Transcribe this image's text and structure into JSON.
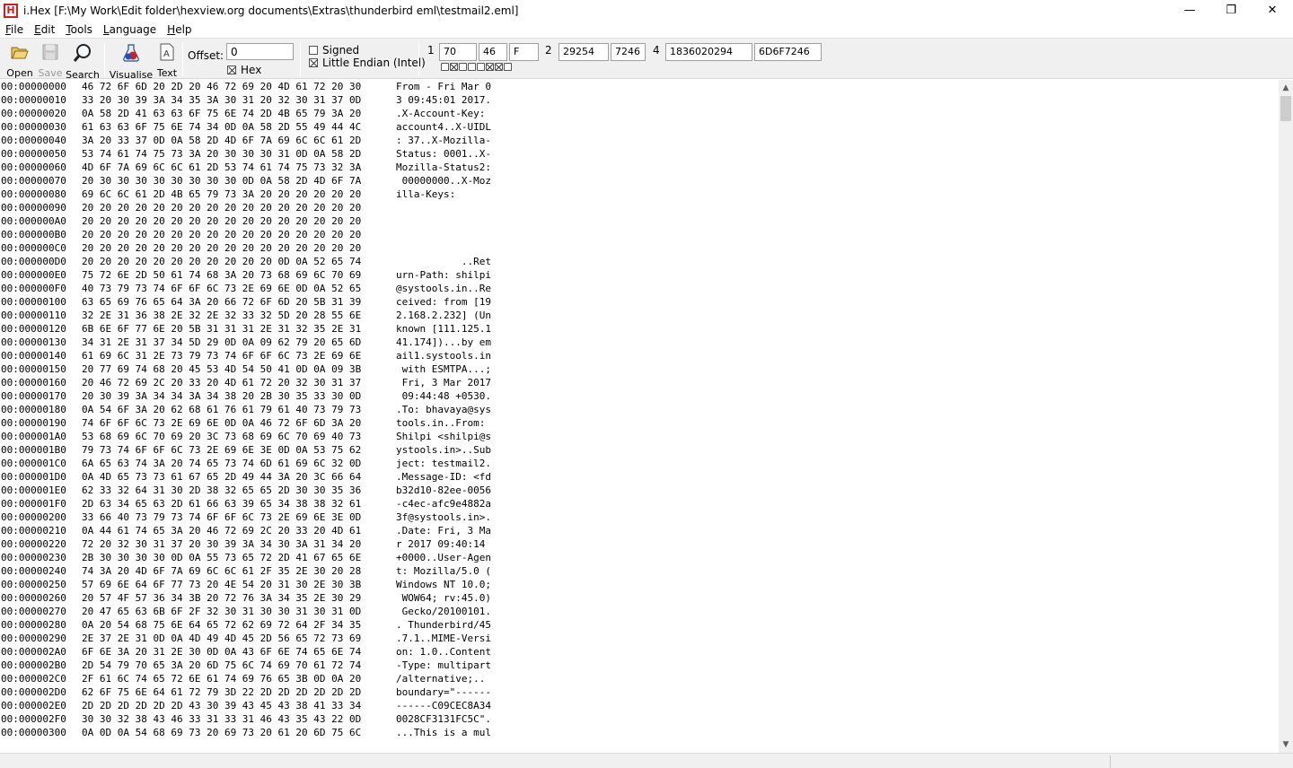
{
  "window": {
    "title": "i.Hex [F:\\My Work\\Edit folder\\hexview.org documents\\Extras\\thunderbird eml\\testmail2.eml]",
    "icon_letter": "H",
    "minimize": "—",
    "restore": "❐",
    "close": "✕"
  },
  "menu": [
    {
      "first": "F",
      "rest": "ile"
    },
    {
      "first": "E",
      "rest": "dit"
    },
    {
      "first": "T",
      "rest": "ools"
    },
    {
      "first": "L",
      "rest": "anguage"
    },
    {
      "first": "H",
      "rest": "elp"
    }
  ],
  "toolbar": {
    "open": "Open",
    "save": "Save",
    "search": "Search",
    "visualise": "Visualise",
    "text": "Text",
    "offset_label": "Offset:",
    "offset_value": "0",
    "hex_label": "Hex",
    "signed_label": "Signed",
    "little_endian_label": "Little Endian (Intel)",
    "n1": "1",
    "n2": "2",
    "n4": "4",
    "byte_dec": "70",
    "byte_hex": "46",
    "byte_char": "F",
    "word_dec": "29254",
    "word_hex": "7246",
    "dword_dec": "1836020294",
    "dword_hex": "6D6F7246",
    "bits": [
      false,
      true,
      false,
      false,
      false,
      true,
      true,
      false
    ]
  },
  "hex_rows": [
    {
      "off": "00:00000000",
      "hex": "46 72 6F 6D 20 2D 20 46 72 69 20 4D 61 72 20 30",
      "text": "From - Fri Mar 0"
    },
    {
      "off": "00:00000010",
      "hex": "33 20 30 39 3A 34 35 3A 30 31 20 32 30 31 37 0D",
      "text": "3 09:45:01 2017."
    },
    {
      "off": "00:00000020",
      "hex": "0A 58 2D 41 63 63 6F 75 6E 74 2D 4B 65 79 3A 20",
      "text": ".X-Account-Key: "
    },
    {
      "off": "00:00000030",
      "hex": "61 63 63 6F 75 6E 74 34 0D 0A 58 2D 55 49 44 4C",
      "text": "account4..X-UIDL"
    },
    {
      "off": "00:00000040",
      "hex": "3A 20 33 37 0D 0A 58 2D 4D 6F 7A 69 6C 6C 61 2D",
      "text": ": 37..X-Mozilla-"
    },
    {
      "off": "00:00000050",
      "hex": "53 74 61 74 75 73 3A 20 30 30 30 31 0D 0A 58 2D",
      "text": "Status: 0001..X-"
    },
    {
      "off": "00:00000060",
      "hex": "4D 6F 7A 69 6C 6C 61 2D 53 74 61 74 75 73 32 3A",
      "text": "Mozilla-Status2:"
    },
    {
      "off": "00:00000070",
      "hex": "20 30 30 30 30 30 30 30 30 0D 0A 58 2D 4D 6F 7A",
      "text": " 00000000..X-Moz"
    },
    {
      "off": "00:00000080",
      "hex": "69 6C 6C 61 2D 4B 65 79 73 3A 20 20 20 20 20 20",
      "text": "illa-Keys:      "
    },
    {
      "off": "00:00000090",
      "hex": "20 20 20 20 20 20 20 20 20 20 20 20 20 20 20 20",
      "text": "                "
    },
    {
      "off": "00:000000A0",
      "hex": "20 20 20 20 20 20 20 20 20 20 20 20 20 20 20 20",
      "text": "                "
    },
    {
      "off": "00:000000B0",
      "hex": "20 20 20 20 20 20 20 20 20 20 20 20 20 20 20 20",
      "text": "                "
    },
    {
      "off": "00:000000C0",
      "hex": "20 20 20 20 20 20 20 20 20 20 20 20 20 20 20 20",
      "text": "                "
    },
    {
      "off": "00:000000D0",
      "hex": "20 20 20 20 20 20 20 20 20 20 20 0D 0A 52 65 74",
      "text": "           ..Ret"
    },
    {
      "off": "00:000000E0",
      "hex": "75 72 6E 2D 50 61 74 68 3A 20 73 68 69 6C 70 69",
      "text": "urn-Path: shilpi"
    },
    {
      "off": "00:000000F0",
      "hex": "40 73 79 73 74 6F 6F 6C 73 2E 69 6E 0D 0A 52 65",
      "text": "@systools.in..Re"
    },
    {
      "off": "00:00000100",
      "hex": "63 65 69 76 65 64 3A 20 66 72 6F 6D 20 5B 31 39",
      "text": "ceived: from [19"
    },
    {
      "off": "00:00000110",
      "hex": "32 2E 31 36 38 2E 32 2E 32 33 32 5D 20 28 55 6E",
      "text": "2.168.2.232] (Un"
    },
    {
      "off": "00:00000120",
      "hex": "6B 6E 6F 77 6E 20 5B 31 31 31 2E 31 32 35 2E 31",
      "text": "known [111.125.1"
    },
    {
      "off": "00:00000130",
      "hex": "34 31 2E 31 37 34 5D 29 0D 0A 09 62 79 20 65 6D",
      "text": "41.174])...by em"
    },
    {
      "off": "00:00000140",
      "hex": "61 69 6C 31 2E 73 79 73 74 6F 6F 6C 73 2E 69 6E",
      "text": "ail1.systools.in"
    },
    {
      "off": "00:00000150",
      "hex": "20 77 69 74 68 20 45 53 4D 54 50 41 0D 0A 09 3B",
      "text": " with ESMTPA...;"
    },
    {
      "off": "00:00000160",
      "hex": "20 46 72 69 2C 20 33 20 4D 61 72 20 32 30 31 37",
      "text": " Fri, 3 Mar 2017"
    },
    {
      "off": "00:00000170",
      "hex": "20 30 39 3A 34 34 3A 34 38 20 2B 30 35 33 30 0D",
      "text": " 09:44:48 +0530."
    },
    {
      "off": "00:00000180",
      "hex": "0A 54 6F 3A 20 62 68 61 76 61 79 61 40 73 79 73",
      "text": ".To: bhavaya@sys"
    },
    {
      "off": "00:00000190",
      "hex": "74 6F 6F 6C 73 2E 69 6E 0D 0A 46 72 6F 6D 3A 20",
      "text": "tools.in..From: "
    },
    {
      "off": "00:000001A0",
      "hex": "53 68 69 6C 70 69 20 3C 73 68 69 6C 70 69 40 73",
      "text": "Shilpi <shilpi@s"
    },
    {
      "off": "00:000001B0",
      "hex": "79 73 74 6F 6F 6C 73 2E 69 6E 3E 0D 0A 53 75 62",
      "text": "ystools.in>..Sub"
    },
    {
      "off": "00:000001C0",
      "hex": "6A 65 63 74 3A 20 74 65 73 74 6D 61 69 6C 32 0D",
      "text": "ject: testmail2."
    },
    {
      "off": "00:000001D0",
      "hex": "0A 4D 65 73 73 61 67 65 2D 49 44 3A 20 3C 66 64",
      "text": ".Message-ID: <fd"
    },
    {
      "off": "00:000001E0",
      "hex": "62 33 32 64 31 30 2D 38 32 65 65 2D 30 30 35 36",
      "text": "b32d10-82ee-0056"
    },
    {
      "off": "00:000001F0",
      "hex": "2D 63 34 65 63 2D 61 66 63 39 65 34 38 38 32 61",
      "text": "-c4ec-afc9e4882a"
    },
    {
      "off": "00:00000200",
      "hex": "33 66 40 73 79 73 74 6F 6F 6C 73 2E 69 6E 3E 0D",
      "text": "3f@systools.in>."
    },
    {
      "off": "00:00000210",
      "hex": "0A 44 61 74 65 3A 20 46 72 69 2C 20 33 20 4D 61",
      "text": ".Date: Fri, 3 Ma"
    },
    {
      "off": "00:00000220",
      "hex": "72 20 32 30 31 37 20 30 39 3A 34 30 3A 31 34 20",
      "text": "r 2017 09:40:14 "
    },
    {
      "off": "00:00000230",
      "hex": "2B 30 30 30 30 0D 0A 55 73 65 72 2D 41 67 65 6E",
      "text": "+0000..User-Agen"
    },
    {
      "off": "00:00000240",
      "hex": "74 3A 20 4D 6F 7A 69 6C 6C 61 2F 35 2E 30 20 28",
      "text": "t: Mozilla/5.0 ("
    },
    {
      "off": "00:00000250",
      "hex": "57 69 6E 64 6F 77 73 20 4E 54 20 31 30 2E 30 3B",
      "text": "Windows NT 10.0;"
    },
    {
      "off": "00:00000260",
      "hex": "20 57 4F 57 36 34 3B 20 72 76 3A 34 35 2E 30 29",
      "text": " WOW64; rv:45.0)"
    },
    {
      "off": "00:00000270",
      "hex": "20 47 65 63 6B 6F 2F 32 30 31 30 30 31 30 31 0D",
      "text": " Gecko/20100101."
    },
    {
      "off": "00:00000280",
      "hex": "0A 20 54 68 75 6E 64 65 72 62 69 72 64 2F 34 35",
      "text": ". Thunderbird/45"
    },
    {
      "off": "00:00000290",
      "hex": "2E 37 2E 31 0D 0A 4D 49 4D 45 2D 56 65 72 73 69",
      "text": ".7.1..MIME-Versi"
    },
    {
      "off": "00:000002A0",
      "hex": "6F 6E 3A 20 31 2E 30 0D 0A 43 6F 6E 74 65 6E 74",
      "text": "on: 1.0..Content"
    },
    {
      "off": "00:000002B0",
      "hex": "2D 54 79 70 65 3A 20 6D 75 6C 74 69 70 61 72 74",
      "text": "-Type: multipart"
    },
    {
      "off": "00:000002C0",
      "hex": "2F 61 6C 74 65 72 6E 61 74 69 76 65 3B 0D 0A 20",
      "text": "/alternative;.. "
    },
    {
      "off": "00:000002D0",
      "hex": "62 6F 75 6E 64 61 72 79 3D 22 2D 2D 2D 2D 2D 2D",
      "text": "boundary=\"------"
    },
    {
      "off": "00:000002E0",
      "hex": "2D 2D 2D 2D 2D 2D 43 30 39 43 45 43 38 41 33 34",
      "text": "------C09CEC8A34"
    },
    {
      "off": "00:000002F0",
      "hex": "30 30 32 38 43 46 33 31 33 31 46 43 35 43 22 0D",
      "text": "0028CF3131FC5C\"."
    },
    {
      "off": "00:00000300",
      "hex": "0A 0D 0A 54 68 69 73 20 69 73 20 61 20 6D 75 6C",
      "text": "...This is a mul"
    }
  ]
}
